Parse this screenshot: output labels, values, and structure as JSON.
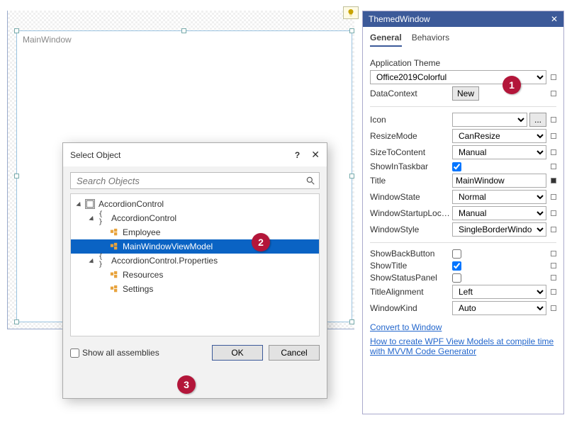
{
  "designer": {
    "title": "MainWindow"
  },
  "panel": {
    "header": "ThemedWindow",
    "tabs": {
      "general": "General",
      "behaviors": "Behaviors",
      "active": "general"
    },
    "theme": {
      "label": "Application Theme",
      "value": "Office2019Colorful"
    },
    "datacontext": {
      "label": "DataContext",
      "new_button": "New"
    },
    "rows": {
      "Icon": {
        "label": "Icon",
        "type": "combo-browse",
        "value": ""
      },
      "ResizeMode": {
        "label": "ResizeMode",
        "type": "select",
        "value": "CanResize"
      },
      "SizeToContent": {
        "label": "SizeToContent",
        "type": "select",
        "value": "Manual"
      },
      "ShowInTaskbar": {
        "label": "ShowInTaskbar",
        "type": "check",
        "value": true
      },
      "Title": {
        "label": "Title",
        "type": "text",
        "value": "MainWindow",
        "filled": true
      },
      "WindowState": {
        "label": "WindowState",
        "type": "select",
        "value": "Normal"
      },
      "WindowStartupLocation": {
        "label": "WindowStartupLocat...",
        "type": "select",
        "value": "Manual"
      },
      "WindowStyle": {
        "label": "WindowStyle",
        "type": "select",
        "value": "SingleBorderWindow"
      },
      "ShowBackButton": {
        "label": "ShowBackButton",
        "type": "check",
        "value": false
      },
      "ShowTitle": {
        "label": "ShowTitle",
        "type": "check",
        "value": true
      },
      "ShowStatusPanel": {
        "label": "ShowStatusPanel",
        "type": "check",
        "value": false
      },
      "TitleAlignment": {
        "label": "TitleAlignment",
        "type": "select",
        "value": "Left"
      },
      "WindowKind": {
        "label": "WindowKind",
        "type": "select",
        "value": "Auto"
      }
    },
    "links": {
      "convert": "Convert to Window",
      "howto": "How to create WPF View Models at compile time with MVVM Code Generator"
    }
  },
  "dialog": {
    "title": "Select Object",
    "search_placeholder": "Search Objects",
    "tree": [
      {
        "depth": 0,
        "kind": "asm",
        "label": "AccordionControl",
        "expanded": true
      },
      {
        "depth": 1,
        "kind": "ns",
        "label": "AccordionControl",
        "expanded": true
      },
      {
        "depth": 2,
        "kind": "cls",
        "label": "Employee"
      },
      {
        "depth": 2,
        "kind": "cls",
        "label": "MainWindowViewModel",
        "selected": true
      },
      {
        "depth": 1,
        "kind": "ns",
        "label": "AccordionControl.Properties",
        "expanded": true
      },
      {
        "depth": 2,
        "kind": "cls",
        "label": "Resources"
      },
      {
        "depth": 2,
        "kind": "cls",
        "label": "Settings"
      }
    ],
    "show_all": "Show all assemblies",
    "ok": "OK",
    "cancel": "Cancel"
  },
  "callouts": {
    "1": "1",
    "2": "2",
    "3": "3"
  }
}
